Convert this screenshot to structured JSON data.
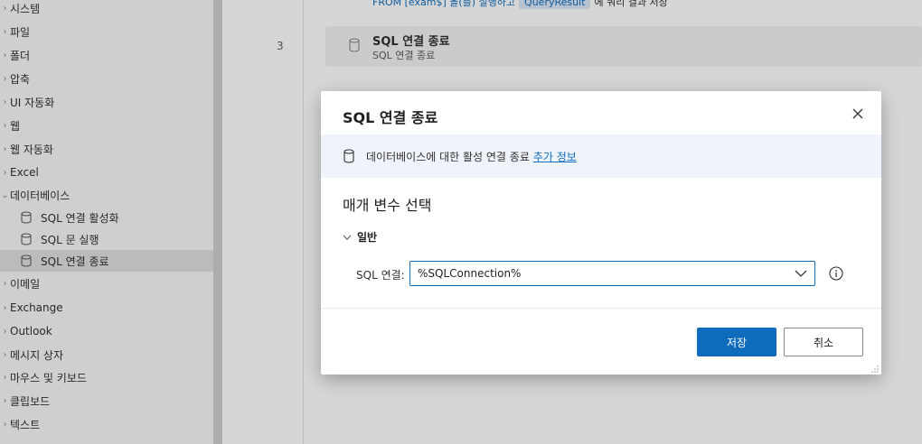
{
  "sidebar": {
    "items": [
      {
        "label": "시스템",
        "expandable": true
      },
      {
        "label": "파일",
        "expandable": true
      },
      {
        "label": "폴더",
        "expandable": true
      },
      {
        "label": "압축",
        "expandable": true
      },
      {
        "label": "UI 자동화",
        "expandable": true
      },
      {
        "label": "웹",
        "expandable": true
      },
      {
        "label": "웹 자동화",
        "expandable": true
      },
      {
        "label": "Excel",
        "expandable": true
      },
      {
        "label": "데이터베이스",
        "expandable": true,
        "expanded": true
      },
      {
        "label": "SQL 연결 활성화",
        "sub": true,
        "icon": "database-icon"
      },
      {
        "label": "SQL 문 실행",
        "sub": true,
        "icon": "database-icon"
      },
      {
        "label": "SQL 연결 종료",
        "sub": true,
        "icon": "database-icon",
        "selected": true
      },
      {
        "label": "이메일",
        "expandable": true
      },
      {
        "label": "Exchange",
        "expandable": true
      },
      {
        "label": "Outlook",
        "expandable": true
      },
      {
        "label": "메시지 상자",
        "expandable": true
      },
      {
        "label": "마우스 및 키보드",
        "expandable": true
      },
      {
        "label": "클립보드",
        "expandable": true
      },
      {
        "label": "텍스트",
        "expandable": true
      }
    ]
  },
  "canvas": {
    "prev_step": {
      "part1": "FROM [exam$] 을(를) 실행하고",
      "chip": "QueryResult",
      "part2": "에 쿼리 결과 저장"
    },
    "line_number": "3",
    "step_title": "SQL 연결 종료",
    "step_subtitle": "SQL 연결 종료"
  },
  "dialog": {
    "title": "SQL 연결 종료",
    "info_text": "데이터베이스에 대한 활성 연결 종료",
    "info_link": "추가 정보",
    "section_title": "매개 변수 선택",
    "group_label": "일반",
    "param_label": "SQL 연결:",
    "param_value": "%SQLConnection%",
    "save_label": "저장",
    "cancel_label": "취소"
  },
  "colors": {
    "accent": "#0f6cbd",
    "banner_bg": "#eff4fb",
    "selected_bg": "#e1dfdd"
  }
}
